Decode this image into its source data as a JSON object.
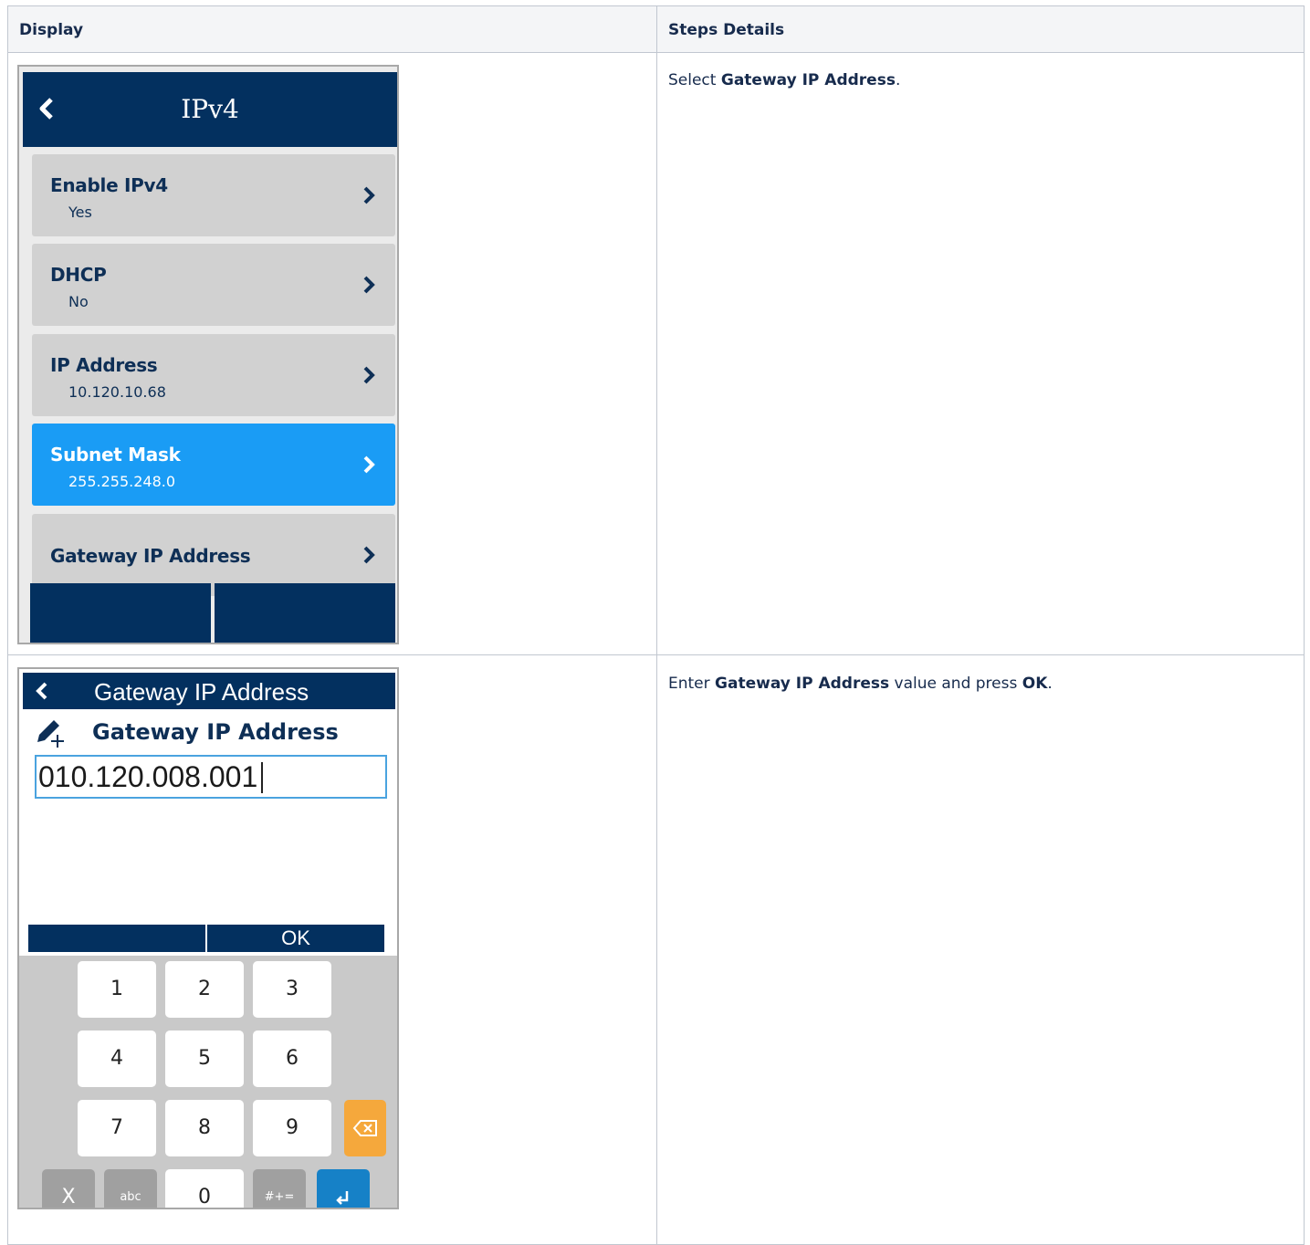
{
  "table": {
    "headers": [
      "Display",
      "Steps Details"
    ],
    "rows": [
      {
        "step_parts": [
          "Select ",
          "Gateway IP Address",
          "."
        ]
      },
      {
        "step_parts": [
          "Enter ",
          "Gateway IP Address",
          " value and press ",
          "OK",
          "."
        ]
      }
    ]
  },
  "screen1": {
    "title": "IPv4",
    "items": [
      {
        "label": "Enable IPv4",
        "value": "Yes"
      },
      {
        "label": "DHCP",
        "value": "No"
      },
      {
        "label": "IP Address",
        "value": "10.120.10.68"
      },
      {
        "label": "Subnet Mask",
        "value": "255.255.248.0"
      },
      {
        "label": "Gateway IP Address",
        "value": ""
      }
    ],
    "selected_index": 3
  },
  "screen2": {
    "title": "Gateway IP Address",
    "field_label": "Gateway IP Address",
    "field_value": "010.120.008.001",
    "softkeys": [
      "",
      "OK"
    ],
    "keys": {
      "row1": [
        "1",
        "2",
        "3"
      ],
      "row2": [
        "4",
        "5",
        "6"
      ],
      "row3": [
        "7",
        "8",
        "9"
      ],
      "row4": [
        "X",
        "abc",
        "0",
        "#+="
      ]
    }
  },
  "colors": {
    "header_navy": "#03305f",
    "selected_blue": "#1a9cf5",
    "backspace_orange": "#f5a83c",
    "enter_blue": "#1681c7"
  }
}
